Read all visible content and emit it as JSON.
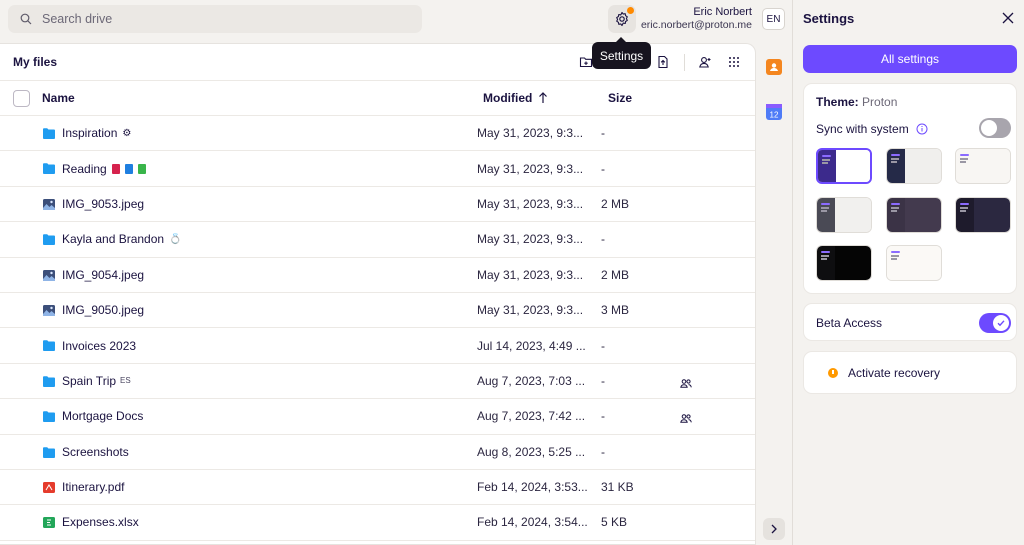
{
  "search": {
    "placeholder": "Search drive"
  },
  "user": {
    "name": "Eric Norbert",
    "email": "eric.norbert@proton.me",
    "language": "EN"
  },
  "tooltip": {
    "text": "Settings"
  },
  "files": {
    "title": "My files",
    "columns": {
      "name": "Name",
      "modified": "Modified",
      "size": "Size"
    },
    "rows": [
      {
        "name": "Inspiration",
        "type": "folder",
        "modified": "May 31, 2023, 9:3...",
        "size": "-",
        "emoji": "⚙"
      },
      {
        "name": "Reading",
        "type": "folder",
        "modified": "May 31, 2023, 9:3...",
        "size": "-"
      },
      {
        "name": "IMG_9053.jpeg",
        "type": "image",
        "modified": "May 31, 2023, 9:3...",
        "size": "2 MB"
      },
      {
        "name": "Kayla and Brandon",
        "type": "folder",
        "modified": "May 31, 2023, 9:3...",
        "size": "-",
        "emoji": "💍"
      },
      {
        "name": "IMG_9054.jpeg",
        "type": "image",
        "modified": "May 31, 2023, 9:3...",
        "size": "2 MB"
      },
      {
        "name": "IMG_9050.jpeg",
        "type": "image",
        "modified": "May 31, 2023, 9:3...",
        "size": "3 MB"
      },
      {
        "name": "Invoices 2023",
        "type": "folder",
        "modified": "Jul 14, 2023, 4:49 ...",
        "size": "-"
      },
      {
        "name": "Spain Trip",
        "type": "folder",
        "modified": "Aug 7, 2023, 7:03 ...",
        "size": "-",
        "suffix": "ES",
        "shared": true
      },
      {
        "name": "Mortgage Docs",
        "type": "folder",
        "modified": "Aug 7, 2023, 7:42 ...",
        "size": "-",
        "shared": true
      },
      {
        "name": "Screenshots",
        "type": "folder",
        "modified": "Aug 8, 2023, 5:25 ...",
        "size": "-"
      },
      {
        "name": "Itinerary.pdf",
        "type": "pdf",
        "modified": "Feb 14, 2024, 3:53...",
        "size": "31 KB"
      },
      {
        "name": "Expenses.xlsx",
        "type": "sheet",
        "modified": "Feb 14, 2024, 3:54...",
        "size": "5 KB"
      }
    ]
  },
  "settings": {
    "title": "Settings",
    "all_settings": "All settings",
    "theme_label": "Theme:",
    "theme_value": "Proton",
    "sync_label": "Sync with system",
    "sync_on": false,
    "beta_label": "Beta Access",
    "beta_on": true,
    "recovery_label": "Activate recovery",
    "themes": [
      {
        "sidebar": "#3c2a8c",
        "main": "#ffffff",
        "selected": true
      },
      {
        "sidebar": "#252a48",
        "main": "#f0efed"
      },
      {
        "sidebar": "#f8f6f3",
        "main": "#f8f6f3"
      },
      {
        "sidebar": "#4a4a55",
        "main": "#f1f0ee"
      },
      {
        "sidebar": "#3b3346",
        "main": "#433a4e"
      },
      {
        "sidebar": "#1e1b2c",
        "main": "#2b2840"
      },
      {
        "sidebar": "#0e0e10",
        "main": "#050505"
      },
      {
        "sidebar": "#fbf9f6",
        "main": "#fbf9f6"
      }
    ]
  },
  "colors": {
    "accent": "#6d4aff",
    "folder": "#1f9cf0",
    "notification": "#ff8a00"
  }
}
